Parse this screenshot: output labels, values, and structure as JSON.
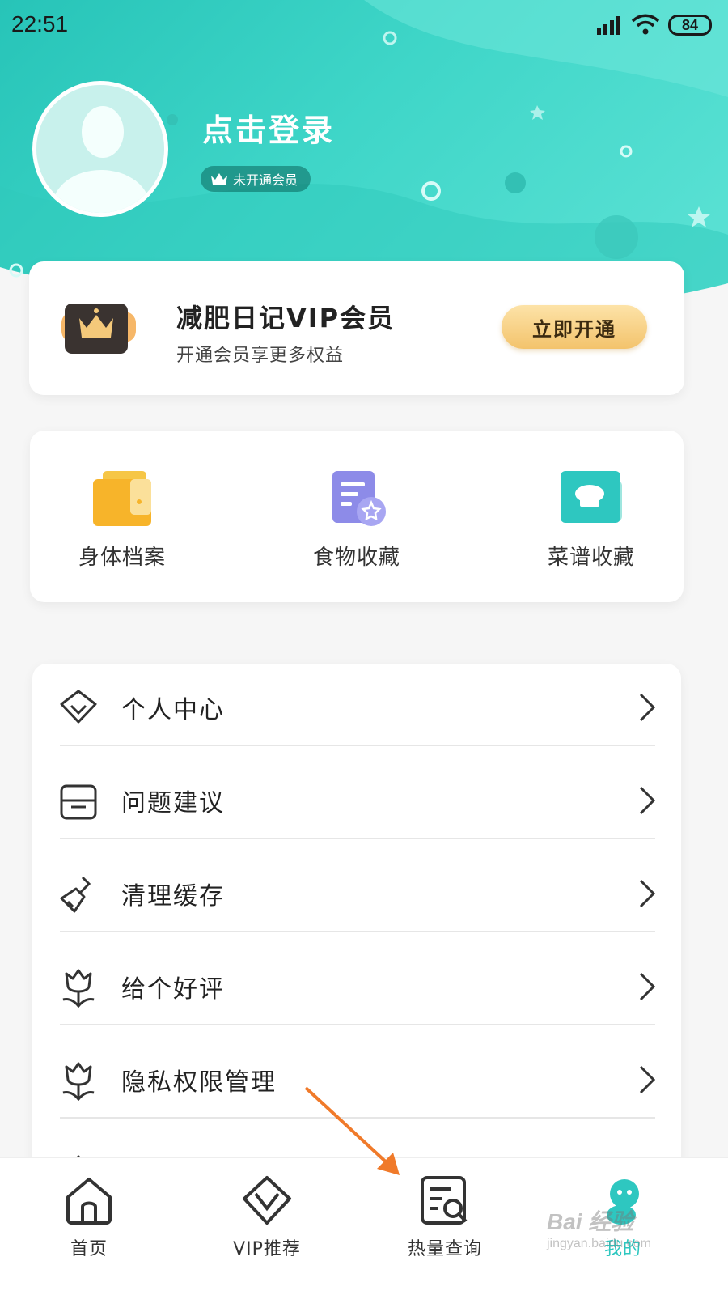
{
  "status_bar": {
    "time": "22:51",
    "battery": "84"
  },
  "profile": {
    "login_title": "点击登录",
    "vip_status": "未开通会员"
  },
  "vip_card": {
    "title": "减肥日记VIP会员",
    "subtitle": "开通会员享更多权益",
    "button": "立即开通"
  },
  "shortcuts": [
    {
      "label": "身体档案",
      "icon": "wallet-icon"
    },
    {
      "label": "食物收藏",
      "icon": "document-star-icon"
    },
    {
      "label": "菜谱收藏",
      "icon": "chef-hat-icon"
    }
  ],
  "menu": [
    {
      "label": "个人中心",
      "icon": "diamond-icon"
    },
    {
      "label": "问题建议",
      "icon": "inbox-icon"
    },
    {
      "label": "清理缓存",
      "icon": "brush-icon"
    },
    {
      "label": "给个好评",
      "icon": "tulip-icon"
    },
    {
      "label": "隐私权限管理",
      "icon": "tulip-icon"
    }
  ],
  "tabbar": [
    {
      "label": "首页",
      "icon": "home-icon"
    },
    {
      "label": "VIP推荐",
      "icon": "vip-v-icon"
    },
    {
      "label": "热量查询",
      "icon": "calorie-search-icon"
    },
    {
      "label": "我的",
      "icon": "profile-mascot-icon"
    }
  ],
  "watermark": {
    "brand": "Bai 经验",
    "url": "jingyan.baidu.com"
  },
  "colors": {
    "header_teal": "#3fd6c8",
    "vip_gold": "#f3c36c",
    "annotation_arrow": "#f07a2a"
  }
}
